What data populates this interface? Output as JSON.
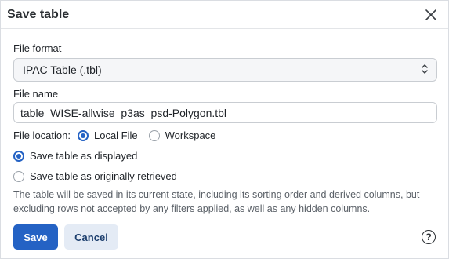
{
  "dialog": {
    "title": "Save table",
    "close_icon": "close-icon"
  },
  "file_format": {
    "label": "File format",
    "selected": "IPAC Table (.tbl)",
    "icon": "chevron-up-down-icon"
  },
  "file_name": {
    "label": "File name",
    "value": "table_WISE-allwise_p3as_psd-Polygon.tbl"
  },
  "file_location": {
    "label": "File location:",
    "options": [
      {
        "label": "Local File",
        "selected": true
      },
      {
        "label": "Workspace",
        "selected": false
      }
    ]
  },
  "save_mode": {
    "options": [
      {
        "label": "Save table as displayed",
        "selected": true
      },
      {
        "label": "Save table as originally retrieved",
        "selected": false
      }
    ]
  },
  "description": "The table will be saved in its current state, including its sorting order and derived columns, but excluding rows not accepted by any filters applied, as well as any hidden columns.",
  "buttons": {
    "save": "Save",
    "cancel": "Cancel",
    "help": "?"
  },
  "colors": {
    "primary": "#2462c4",
    "secondary_bg": "#e4ebf5"
  }
}
